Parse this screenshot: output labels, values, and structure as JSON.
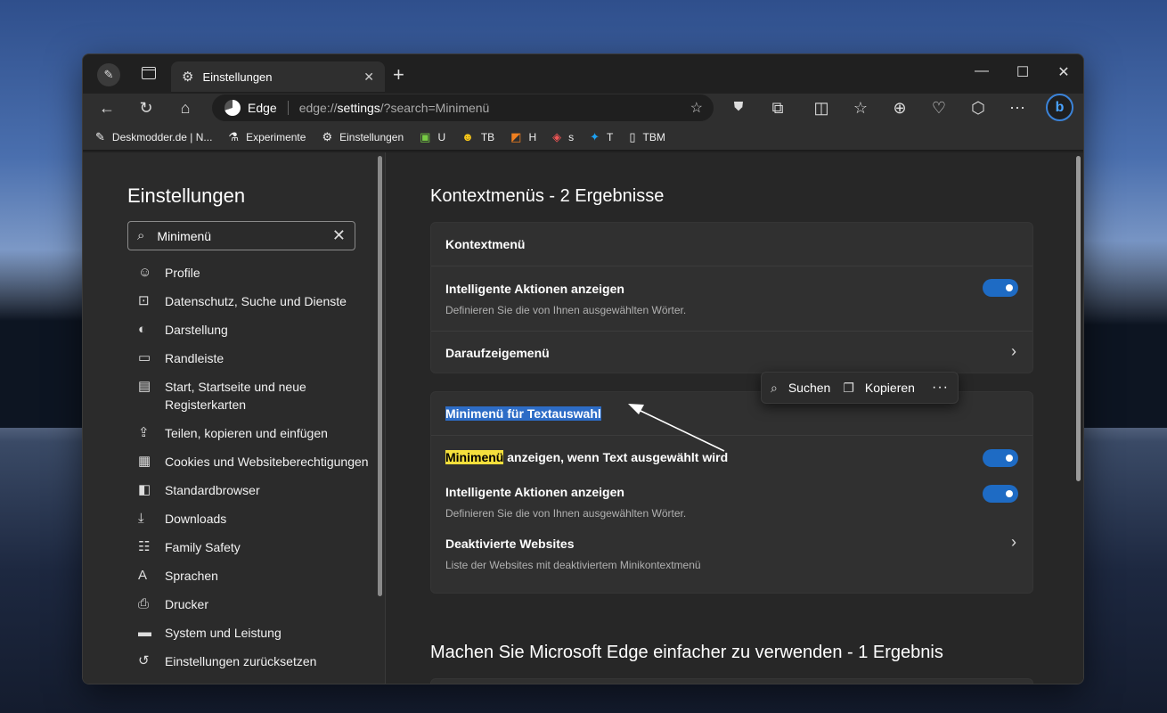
{
  "window": {
    "tab_title": "Einstellungen",
    "new_tab_icon": "plus-icon",
    "controls": [
      "—",
      "☐",
      "✕"
    ]
  },
  "address_bar": {
    "site_label": "Edge",
    "url_prefix": "edge://",
    "url_host": "settings",
    "url_rest": "/?search=Minimenü"
  },
  "favorites": [
    {
      "label": "Deskmodder.de | N...",
      "icon": "pen-icon"
    },
    {
      "label": "Experimente",
      "icon": "flask-icon"
    },
    {
      "label": "Einstellungen",
      "icon": "gear-icon"
    },
    {
      "label": "U",
      "icon": "ublock-icon"
    },
    {
      "label": "TB",
      "icon": "smiley-icon"
    },
    {
      "label": "H",
      "icon": "extension-icon"
    },
    {
      "label": "s",
      "icon": "app-icon"
    },
    {
      "label": "T",
      "icon": "twitter-icon"
    },
    {
      "label": "TBM",
      "icon": "page-icon"
    }
  ],
  "sidebar": {
    "title": "Einstellungen",
    "search_value": "Minimenü",
    "items": [
      {
        "label": "Profile"
      },
      {
        "label": "Datenschutz, Suche und Dienste"
      },
      {
        "label": "Darstellung"
      },
      {
        "label": "Randleiste"
      },
      {
        "label": "Start, Startseite und neue Registerkarten"
      },
      {
        "label": "Teilen, kopieren und einfügen"
      },
      {
        "label": "Cookies und Websiteberechtigungen"
      },
      {
        "label": "Standardbrowser"
      },
      {
        "label": "Downloads"
      },
      {
        "label": "Family Safety"
      },
      {
        "label": "Sprachen"
      },
      {
        "label": "Drucker"
      },
      {
        "label": "System und Leistung"
      },
      {
        "label": "Einstellungen zurücksetzen"
      }
    ]
  },
  "main": {
    "section1_title": "Kontextmenüs - 2 Ergebnisse",
    "card1": {
      "header": "Kontextmenü",
      "row1_title": "Intelligente Aktionen anzeigen",
      "row1_desc": "Definieren Sie die von Ihnen ausgewählten Wörter.",
      "row2_title": "Daraufzeigemenü"
    },
    "card2": {
      "header_selected": "Minimenü",
      "header_rest": " für Textauswahl",
      "row1_highlight": "Minimenü",
      "row1_rest": " anzeigen, wenn Text ausgewählt wird",
      "row2_title": "Intelligente Aktionen anzeigen",
      "row2_desc": "Definieren Sie die von Ihnen ausgewählten Wörter.",
      "row3_title": "Deaktivierte Websites",
      "row3_desc": "Liste der Websites mit deaktiviertem Minikontextmenü"
    },
    "section2_title": "Machen Sie Microsoft Edge einfacher zu verwenden - 1 Ergebnis"
  },
  "mini_menu": {
    "search_label": "Suchen",
    "copy_label": "Kopieren",
    "more_label": "···"
  },
  "toggles": {
    "smart_actions_1": true,
    "show_mini_menu": true,
    "smart_actions_2": true
  },
  "colors": {
    "accent": "#1e6bc4",
    "selection": "#2d6cc6",
    "highlight": "#f4df3c"
  }
}
